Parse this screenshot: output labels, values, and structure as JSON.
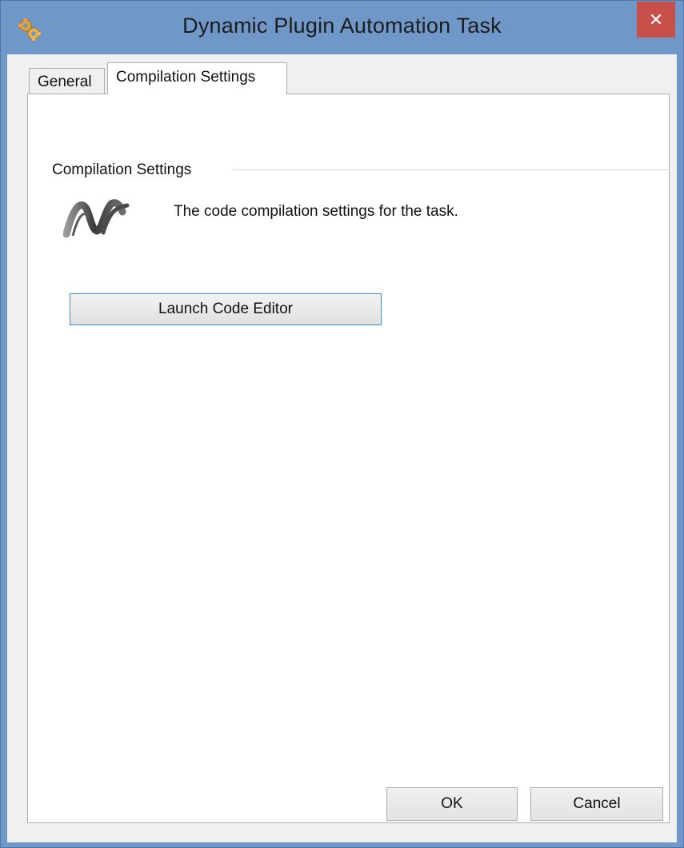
{
  "window": {
    "title": "Dynamic Plugin Automation Task",
    "app_icon": "gears-icon",
    "close_icon": "close-icon",
    "close_glyph": "✕",
    "accent_color": "#6f97c8",
    "close_color": "#c7504a"
  },
  "tabs": [
    {
      "label": "General",
      "selected": false
    },
    {
      "label": "Compilation Settings",
      "selected": true
    }
  ],
  "panel": {
    "group_label": "Compilation Settings",
    "logo_icon": "dotnet-logo-icon",
    "description": "The code compilation settings for the task.",
    "launch_button_label": "Launch Code Editor"
  },
  "footer": {
    "ok_label": "OK",
    "cancel_label": "Cancel"
  }
}
